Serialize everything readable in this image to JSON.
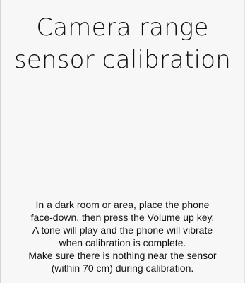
{
  "screen": {
    "title": "Camera range\nsensor calibration",
    "instructions": [
      "In a dark room or area, place the phone",
      "face-down, then press the Volume up key.",
      "A tone will play and the phone will vibrate",
      "when calibration is complete.",
      "Make sure there is nothing near the sensor",
      "(within 70 cm) during calibration."
    ]
  }
}
